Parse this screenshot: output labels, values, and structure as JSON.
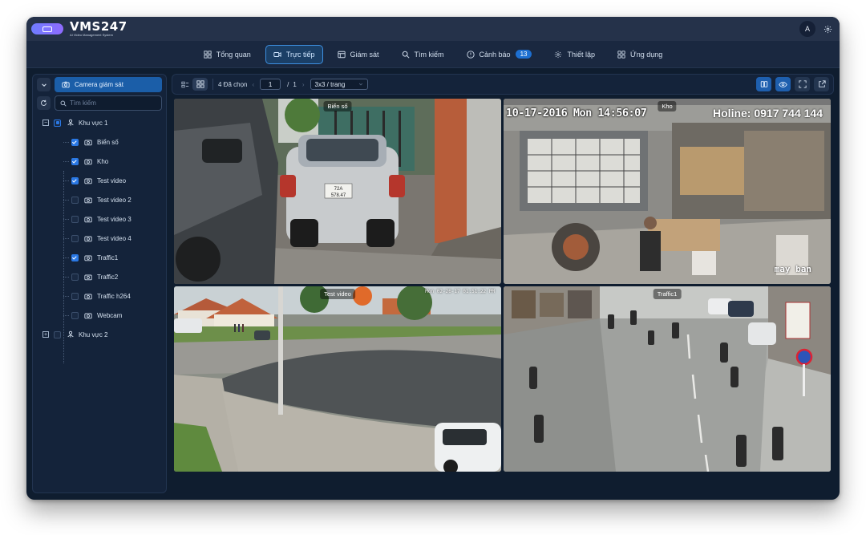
{
  "brand": {
    "name": "VMS247",
    "tagline": "AI Video Management System"
  },
  "user": {
    "avatar_initial": "A"
  },
  "nav": [
    {
      "label": "Tổng quan",
      "icon": "dashboard-icon",
      "active": false
    },
    {
      "label": "Trực tiếp",
      "icon": "video-camera-icon",
      "active": true
    },
    {
      "label": "Giám sát",
      "icon": "monitor-icon",
      "active": false
    },
    {
      "label": "Tìm kiếm",
      "icon": "search-icon",
      "active": false
    },
    {
      "label": "Cảnh báo",
      "icon": "alert-icon",
      "active": false,
      "badge": "13"
    },
    {
      "label": "Thiết lập",
      "icon": "gear-icon",
      "active": false
    },
    {
      "label": "Ứng dụng",
      "icon": "apps-icon",
      "active": false
    }
  ],
  "sidebar": {
    "camera_button": "Camera giám sát",
    "search_placeholder": "Tìm kiếm",
    "areas": [
      {
        "label": "Khu vực 1",
        "expanded": true,
        "state": "partial",
        "cameras": [
          {
            "label": "Biển số",
            "checked": true
          },
          {
            "label": "Kho",
            "checked": true
          },
          {
            "label": "Test video",
            "checked": true
          },
          {
            "label": "Test video 2",
            "checked": false
          },
          {
            "label": "Test video 3",
            "checked": false
          },
          {
            "label": "Test video 4",
            "checked": false
          },
          {
            "label": "Traffic1",
            "checked": true
          },
          {
            "label": "Traffic2",
            "checked": false
          },
          {
            "label": "Traffic h264",
            "checked": false
          },
          {
            "label": "Webcam",
            "checked": false
          }
        ]
      },
      {
        "label": "Khu vực 2",
        "expanded": false,
        "state": "unchecked",
        "cameras": []
      }
    ]
  },
  "toolbar": {
    "selected": "4 Đã chọn",
    "page_current": "1",
    "page_sep": "/",
    "page_total": "1",
    "per_page": "3x3 / trang"
  },
  "tiles": [
    {
      "label": "Biển số",
      "plate": "72A 578.47"
    },
    {
      "label": "Kho",
      "timestamp": "10-17-2016 Mon 14:56:07",
      "hotline": "Holine: 0917 744 144",
      "overlay_bottom": "may ban"
    },
    {
      "label": "Test video",
      "timestamp": "Mon 02-26-17 01:51:22 PM"
    },
    {
      "label": "Traffic1"
    }
  ],
  "colors": {
    "accent": "#1b5ea8",
    "badge": "#1d6fd1",
    "background": "#0f1d2f"
  }
}
